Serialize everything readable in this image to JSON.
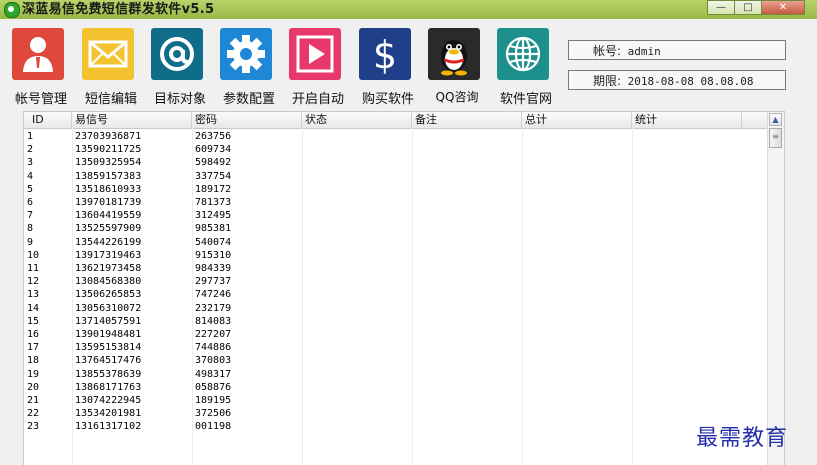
{
  "window": {
    "title": "深蓝易信免费短信群发软件v5.5",
    "minimize": "—",
    "maximize": "□",
    "close": "✕"
  },
  "toolbar": [
    {
      "label": "帐号管理",
      "icon": "account-icon",
      "color": "#e0483c"
    },
    {
      "label": "短信编辑",
      "icon": "envelope-icon",
      "color": "#f2c32e"
    },
    {
      "label": "目标对象",
      "icon": "at-icon",
      "color": "#0f6d8a"
    },
    {
      "label": "参数配置",
      "icon": "gear-icon",
      "color": "#1e88d6"
    },
    {
      "label": "开启自动",
      "icon": "play-icon",
      "color": "#e8386b"
    },
    {
      "label": "购买软件",
      "icon": "dollar-icon",
      "color": "#1f3f8a"
    },
    {
      "label": "QQ咨询",
      "icon": "qq-penguin-icon",
      "color": "#2a2a2a"
    },
    {
      "label": "软件官网",
      "icon": "globe-icon",
      "color": "#1d8f8d"
    }
  ],
  "account": {
    "label": "帐号:",
    "value": "admin"
  },
  "expiry": {
    "label": "期限:",
    "value": "2018-08-08 08.08.08"
  },
  "table": {
    "columns": [
      "ID",
      "易信号",
      "密码",
      "状态",
      "备注",
      "总计",
      "统计"
    ],
    "rows": [
      [
        "1",
        "23703936871",
        "263756"
      ],
      [
        "2",
        "13590211725",
        "609734"
      ],
      [
        "3",
        "13509325954",
        "598492"
      ],
      [
        "4",
        "13859157383",
        "337754"
      ],
      [
        "5",
        "13518610933",
        "189172"
      ],
      [
        "6",
        "13970181739",
        "781373"
      ],
      [
        "7",
        "13604419559",
        "312495"
      ],
      [
        "8",
        "13525597909",
        "985381"
      ],
      [
        "9",
        "13544226199",
        "540074"
      ],
      [
        "10",
        "13917319463",
        "915310"
      ],
      [
        "11",
        "13621973458",
        "984339"
      ],
      [
        "12",
        "13084568380",
        "297737"
      ],
      [
        "13",
        "13506265853",
        "747246"
      ],
      [
        "14",
        "13056310072",
        "232179"
      ],
      [
        "15",
        "13714057591",
        "814083"
      ],
      [
        "16",
        "13901948481",
        "227207"
      ],
      [
        "17",
        "13595153814",
        "744886"
      ],
      [
        "18",
        "13764517476",
        "370803"
      ],
      [
        "19",
        "13855378639",
        "498317"
      ],
      [
        "20",
        "13868171763",
        "058876"
      ],
      [
        "21",
        "13074222945",
        "189195"
      ],
      [
        "22",
        "13534201981",
        "372506"
      ],
      [
        "23",
        "13161317102",
        "001198"
      ]
    ]
  },
  "watermark": "最需教育"
}
